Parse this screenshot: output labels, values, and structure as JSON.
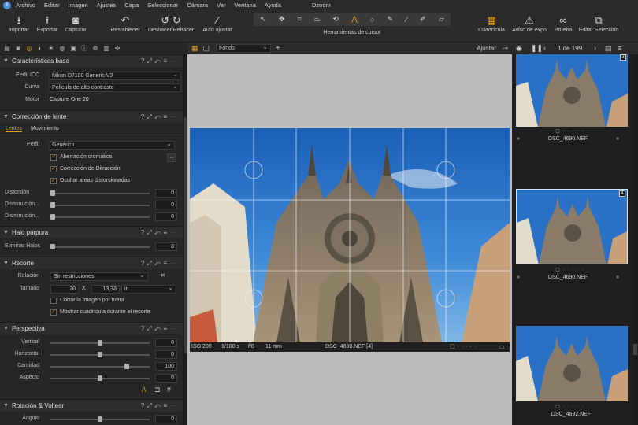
{
  "menu": {
    "items": [
      "Archivo",
      "Editar",
      "Imagen",
      "Ajustes",
      "Capa",
      "Seleccionar",
      "Cámara",
      "Ver",
      "Ventana",
      "Ayuda"
    ],
    "app_title": "Dzoom"
  },
  "toolbar": {
    "import": "Importar",
    "export": "Exportar",
    "capture": "Capturar",
    "reset": "Restablecer",
    "undo_redo": "Deshacer/Rehacer",
    "auto_adjust": "Auto ajustar",
    "cursor_tools": "Herramientas de cursor",
    "grid": "Cuadrícula",
    "exposure_warning": "Aviso de expo",
    "proof": "Prueba",
    "edit_selection": "Editar Selección"
  },
  "basic": {
    "title": "Características base",
    "icc_label": "Perfil ICC",
    "icc_value": "Nikon D7100 Generic V2",
    "curve_label": "Curva",
    "curve_value": "Película de alto contraste",
    "engine_label": "Motor",
    "engine_value": "Capture One 20"
  },
  "lens": {
    "title": "Corrección de lente",
    "tab_lenses": "Lentes",
    "tab_movement": "Movimiento",
    "profile_label": "Perfil",
    "profile_value": "Genérico",
    "chk_chromatic": "Aberración cromática",
    "chk_diffraction": "Corrección de Difracción",
    "chk_hide": "Ocultar areas distorsionadas",
    "distortion_label": "Distorsión",
    "distortion_value": "0",
    "falloff1_label": "Disminución...",
    "falloff1_value": "0",
    "falloff2_label": "Disminución...",
    "falloff2_value": "0",
    "browse_button": "..."
  },
  "halo": {
    "title": "Halo púrpura",
    "remove_label": "Eliminar Halos",
    "remove_value": "0"
  },
  "crop": {
    "title": "Recorte",
    "ratio_label": "Relación",
    "ratio_value": "Sin restricciones",
    "size_label": "Tamaño",
    "width": "20",
    "x": "X",
    "height": "13,33",
    "unit": "in",
    "chk_crop_outside": "Cortar la imagen por fuera",
    "chk_show_grid": "Mostrar cuadrícula durante el recorte"
  },
  "perspective": {
    "title": "Perspectiva",
    "vertical_label": "Vertical",
    "vertical_value": "0",
    "horizontal_label": "Horizontal",
    "horizontal_value": "0",
    "amount_label": "Cantidad",
    "amount_value": "100",
    "aspect_label": "Aspecto",
    "aspect_value": "0",
    "levels": {
      "vertical": 0.5,
      "horizontal": 0.5,
      "amount": 0.78,
      "aspect": 0.5
    }
  },
  "rotation": {
    "title": "Rotación & Voltear",
    "angle_label": "Ángulo",
    "angle_value": "0"
  },
  "viewer": {
    "background": "Fondo",
    "adjust": "Ajustar",
    "iso": "ISO 200",
    "shutter": "1/100 s",
    "aperture": "f/8",
    "focal": "11 mm",
    "filename": "DSC_4690.NEF [4]"
  },
  "browser": {
    "counter": "1 de 199",
    "thumbs": [
      {
        "name": "DSC_4690.NEF",
        "badge": "3"
      },
      {
        "name": "DSC_4690.NEF",
        "badge": "4"
      },
      {
        "name": "DSC_4692.NEF",
        "badge": ""
      }
    ]
  },
  "colors": {
    "accent": "#e8a020",
    "sky": "#2a72c8",
    "stone": "#8a7a68"
  }
}
